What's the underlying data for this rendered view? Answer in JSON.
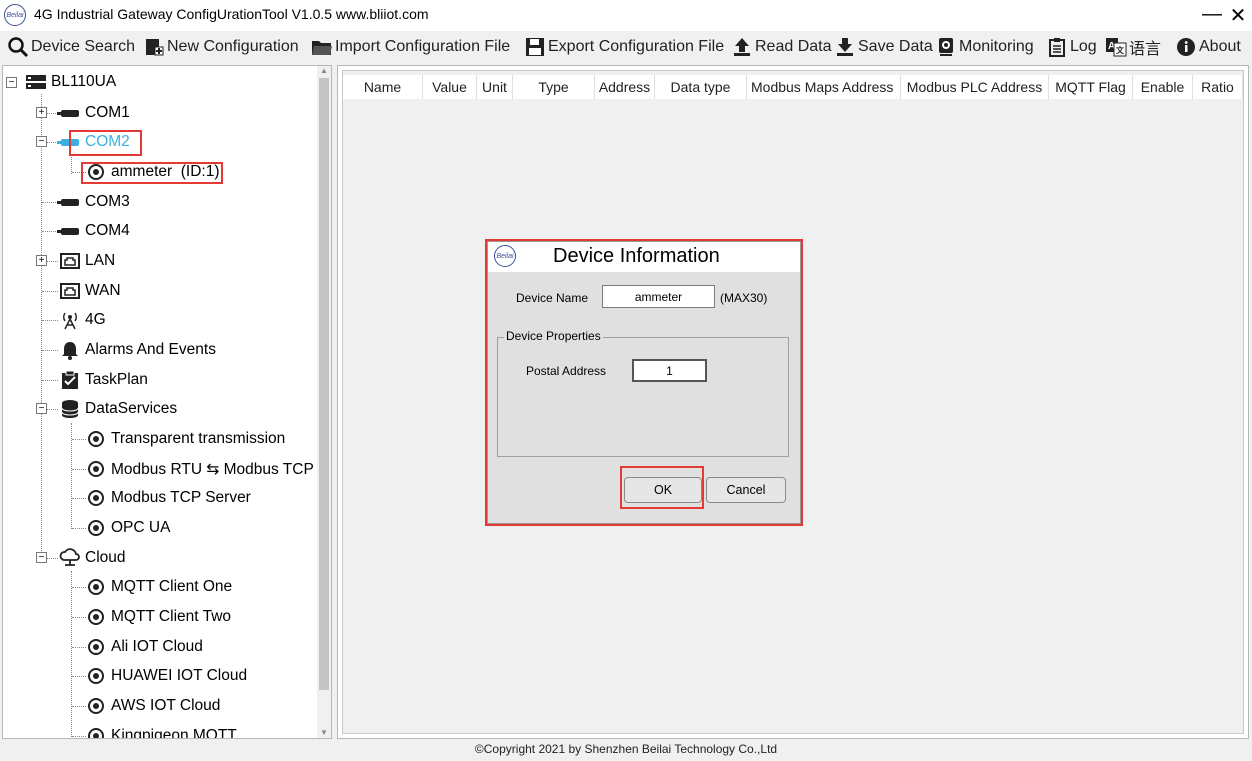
{
  "window": {
    "logo_text": "Beilai",
    "title": "4G Industrial Gateway ConfigUrationTool V1.0.5 www.bliiot.com",
    "minimize": "—",
    "close": "✕"
  },
  "toolbar": {
    "device_search": "Device Search",
    "new_configuration": "New Configuration",
    "import_configuration": "Import Configuration File",
    "export_configuration": "Export Configuration File",
    "read_data": "Read Data",
    "save_data": "Save Data",
    "monitoring": "Monitoring",
    "log": "Log",
    "language": "语言",
    "about": "About"
  },
  "tree": {
    "root": "BL110UA",
    "com1": "COM1",
    "com2": "COM2",
    "ammeter": "ammeter  (ID:1)",
    "com3": "COM3",
    "com4": "COM4",
    "lan": "LAN",
    "wan": "WAN",
    "g4": "4G",
    "alarms": "Alarms And Events",
    "taskplan": "TaskPlan",
    "dataservices": "DataServices",
    "transparent": "Transparent transmission",
    "modbus_rtu_tcp": "Modbus RTU ⇆ Modbus TCP",
    "modbus_tcp_server": "Modbus TCP Server",
    "opc_ua": "OPC UA",
    "cloud": "Cloud",
    "mqtt_one": "MQTT Client One",
    "mqtt_two": "MQTT Client Two",
    "ali": "Ali IOT Cloud",
    "huawei": "HUAWEI IOT Cloud",
    "aws": "AWS IOT Cloud",
    "kingpigeon": "Kingpigeon MQTT"
  },
  "table": {
    "columns": [
      "Name",
      "Value",
      "Unit",
      "Type",
      "Address",
      "Data type",
      "Modbus Maps Address",
      "Modbus PLC Address",
      "MQTT Flag",
      "Enable",
      "Ratio"
    ]
  },
  "dialog": {
    "logo_text": "Beilai",
    "title": "Device Information",
    "device_name_label": "Device Name",
    "device_name_value": "ammeter",
    "device_name_hint": "(MAX30)",
    "group_label": "Device Properties",
    "postal_address_label": "Postal Address",
    "postal_address_value": "1",
    "ok": "OK",
    "cancel": "Cancel"
  },
  "footer": {
    "copyright": "©Copyright 2021 by Shenzhen Beilai Technology Co.,Ltd"
  },
  "colors": {
    "highlight_red": "#e53935",
    "selected_cyan": "#3ab0e0"
  }
}
